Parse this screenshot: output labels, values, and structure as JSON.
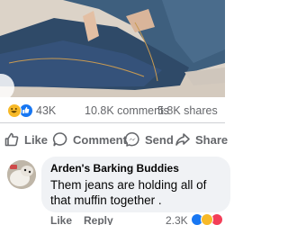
{
  "post": {
    "reaction_count": "43K",
    "comments_count": "10.8K comments",
    "shares_count": "5.8K shares"
  },
  "actions": {
    "like_label": "Like",
    "comment_label": "Comment",
    "send_label": "Send",
    "share_label": "Share"
  },
  "comment": {
    "author": "Arden's Barking Buddies",
    "text": "Them jeans are holding all of that muffin together .",
    "like_label": "Like",
    "reply_label": "Reply",
    "reaction_count": "2.3K"
  },
  "icons": {
    "post_reactions": [
      "laugh-reaction-icon",
      "like-reaction-icon"
    ],
    "comment_reactions": [
      "like-reaction-icon",
      "laugh-reaction-icon",
      "love-reaction-icon"
    ]
  },
  "colors": {
    "like_blue": "#1877f2",
    "laugh_yellow": "#f7b928",
    "love_red": "#f33e58",
    "secondary_text": "#65676b",
    "bubble_bg": "#f0f2f5"
  }
}
